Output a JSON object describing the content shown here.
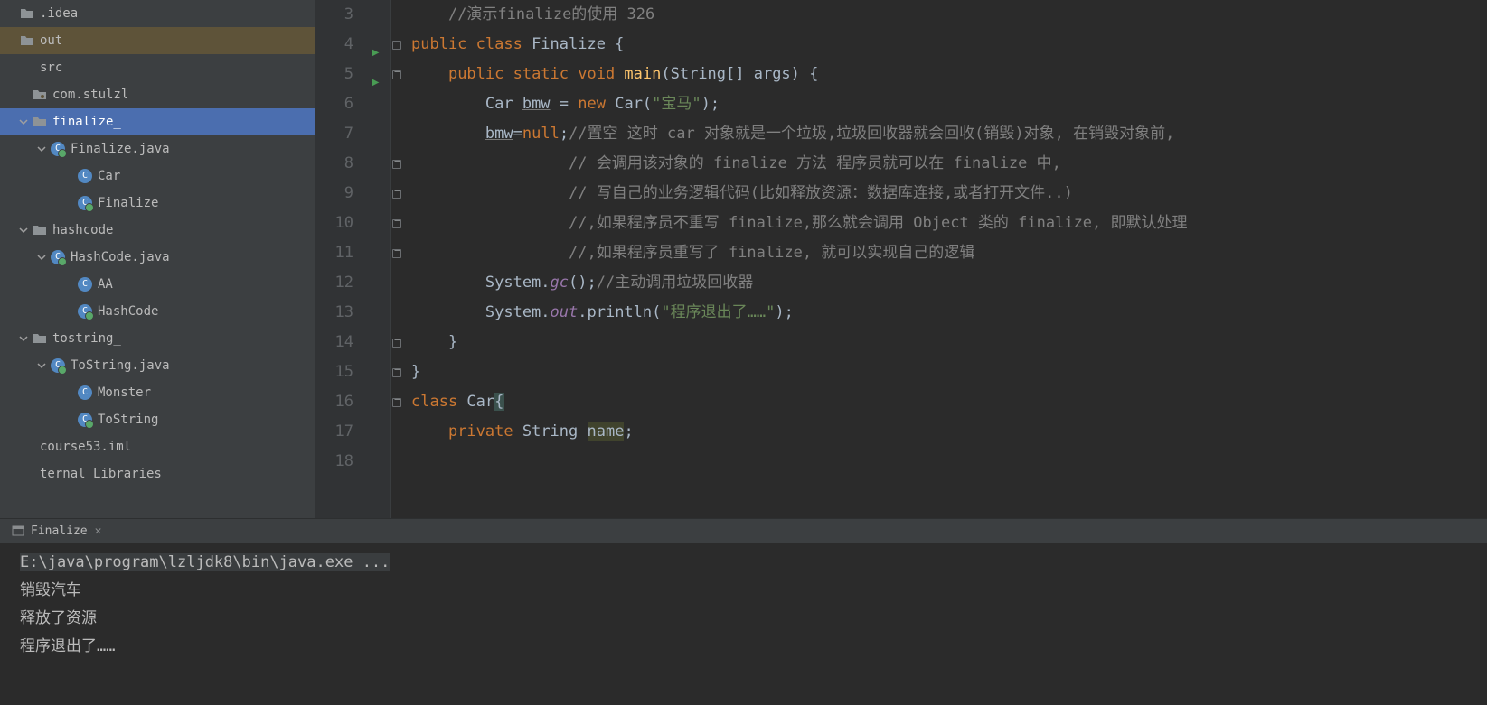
{
  "project_tree": {
    "items": [
      {
        "label": ".idea",
        "depth": 0,
        "chev": "none",
        "icon": "folder"
      },
      {
        "label": "out",
        "depth": 0,
        "chev": "none",
        "icon": "folder",
        "highlight": "out"
      },
      {
        "label": "src",
        "depth": 0,
        "chev": "none",
        "icon": "none"
      },
      {
        "label": "com.stulzl",
        "depth": 1,
        "chev": "none",
        "icon": "package"
      },
      {
        "label": "finalize_",
        "depth": 1,
        "chev": "down",
        "icon": "folder",
        "selected": true
      },
      {
        "label": "Finalize.java",
        "depth": 2,
        "chev": "down",
        "icon": "java-run"
      },
      {
        "label": "Car",
        "depth": 3,
        "chev": "none",
        "icon": "class"
      },
      {
        "label": "Finalize",
        "depth": 3,
        "chev": "none",
        "icon": "class-run"
      },
      {
        "label": "hashcode_",
        "depth": 1,
        "chev": "down",
        "icon": "folder"
      },
      {
        "label": "HashCode.java",
        "depth": 2,
        "chev": "down",
        "icon": "java-run"
      },
      {
        "label": "AA",
        "depth": 3,
        "chev": "none",
        "icon": "class"
      },
      {
        "label": "HashCode",
        "depth": 3,
        "chev": "none",
        "icon": "class-run"
      },
      {
        "label": "tostring_",
        "depth": 1,
        "chev": "down",
        "icon": "folder"
      },
      {
        "label": "ToString.java",
        "depth": 2,
        "chev": "down",
        "icon": "java-run"
      },
      {
        "label": "Monster",
        "depth": 3,
        "chev": "none",
        "icon": "class"
      },
      {
        "label": "ToString",
        "depth": 3,
        "chev": "none",
        "icon": "class-run"
      },
      {
        "label": "course53.iml",
        "depth": 0,
        "chev": "none",
        "icon": "none"
      },
      {
        "label": "ternal Libraries",
        "depth": 0,
        "chev": "none",
        "icon": "none"
      }
    ]
  },
  "editor": {
    "line_start": 3,
    "run_marks": [
      4,
      5
    ],
    "fold_marks": [
      4,
      5,
      8,
      9,
      10,
      11,
      14,
      15,
      16
    ],
    "lines": [
      {
        "n": 3,
        "tokens": [
          {
            "t": "    ",
            "c": ""
          },
          {
            "t": "//演示finalize的使用 326",
            "c": "tk-cmt"
          }
        ]
      },
      {
        "n": 4,
        "tokens": [
          {
            "t": "public class ",
            "c": "tk-kw"
          },
          {
            "t": "Finalize {",
            "c": ""
          }
        ]
      },
      {
        "n": 5,
        "tokens": [
          {
            "t": "    ",
            "c": ""
          },
          {
            "t": "public static void ",
            "c": "tk-kw"
          },
          {
            "t": "main",
            "c": "tk-fn"
          },
          {
            "t": "(String[] args) {",
            "c": ""
          }
        ]
      },
      {
        "n": 6,
        "tokens": [
          {
            "t": "        Car ",
            "c": ""
          },
          {
            "t": "bmw",
            "c": "tk-under"
          },
          {
            "t": " = ",
            "c": ""
          },
          {
            "t": "new ",
            "c": "tk-kw"
          },
          {
            "t": "Car(",
            "c": ""
          },
          {
            "t": "\"宝马\"",
            "c": "tk-str"
          },
          {
            "t": ");",
            "c": ""
          }
        ]
      },
      {
        "n": 7,
        "tokens": [
          {
            "t": "        ",
            "c": ""
          },
          {
            "t": "bmw",
            "c": "tk-under"
          },
          {
            "t": "=",
            "c": ""
          },
          {
            "t": "null",
            "c": "tk-kw"
          },
          {
            "t": ";",
            "c": ""
          },
          {
            "t": "//置空 这时 car 对象就是一个垃圾,垃圾回收器就会回收(销毁)对象, 在销毁对象前,",
            "c": "tk-cmt"
          }
        ]
      },
      {
        "n": 8,
        "tokens": [
          {
            "t": "                 ",
            "c": ""
          },
          {
            "t": "// 会调用该对象的 finalize 方法 程序员就可以在 finalize 中,",
            "c": "tk-cmt"
          }
        ]
      },
      {
        "n": 9,
        "tokens": [
          {
            "t": "                 ",
            "c": ""
          },
          {
            "t": "// 写自己的业务逻辑代码(比如释放资源：数据库连接,或者打开文件..)",
            "c": "tk-cmt"
          }
        ]
      },
      {
        "n": 10,
        "tokens": [
          {
            "t": "                 ",
            "c": ""
          },
          {
            "t": "//,如果程序员不重写 finalize,那么就会调用 Object 类的 finalize, 即默认处理",
            "c": "tk-cmt"
          }
        ]
      },
      {
        "n": 11,
        "tokens": [
          {
            "t": "                 ",
            "c": ""
          },
          {
            "t": "//,如果程序员重写了 finalize, 就可以实现自己的逻辑",
            "c": "tk-cmt"
          }
        ]
      },
      {
        "n": 12,
        "tokens": [
          {
            "t": "        System.",
            "c": ""
          },
          {
            "t": "gc",
            "c": "tk-static"
          },
          {
            "t": "();",
            "c": ""
          },
          {
            "t": "//主动调用垃圾回收器",
            "c": "tk-cmt"
          }
        ]
      },
      {
        "n": 13,
        "tokens": [
          {
            "t": "        System.",
            "c": ""
          },
          {
            "t": "out",
            "c": "tk-static"
          },
          {
            "t": ".println(",
            "c": ""
          },
          {
            "t": "\"程序退出了……\"",
            "c": "tk-str"
          },
          {
            "t": ");",
            "c": ""
          }
        ]
      },
      {
        "n": 14,
        "tokens": [
          {
            "t": "    }",
            "c": ""
          }
        ]
      },
      {
        "n": 15,
        "tokens": [
          {
            "t": "}",
            "c": ""
          }
        ]
      },
      {
        "n": 16,
        "tokens": [
          {
            "t": "class ",
            "c": "tk-kw"
          },
          {
            "t": "Car",
            "c": ""
          },
          {
            "t": "{",
            "c": "cursor-mark"
          }
        ]
      },
      {
        "n": 17,
        "tokens": [
          {
            "t": "    ",
            "c": ""
          },
          {
            "t": "private ",
            "c": "tk-kw"
          },
          {
            "t": "String ",
            "c": ""
          },
          {
            "t": "name",
            "c": "hl-word"
          },
          {
            "t": ";",
            "c": ""
          }
        ]
      },
      {
        "n": 18,
        "tokens": [
          {
            "t": "",
            "c": ""
          }
        ]
      }
    ]
  },
  "run_tab": {
    "label": "Finalize"
  },
  "console": {
    "lines": [
      {
        "text": "E:\\java\\program\\lzljdk8\\bin\\java.exe ...",
        "cmd": true
      },
      {
        "text": "销毁汽车"
      },
      {
        "text": "释放了资源"
      },
      {
        "text": "程序退出了……"
      }
    ]
  }
}
